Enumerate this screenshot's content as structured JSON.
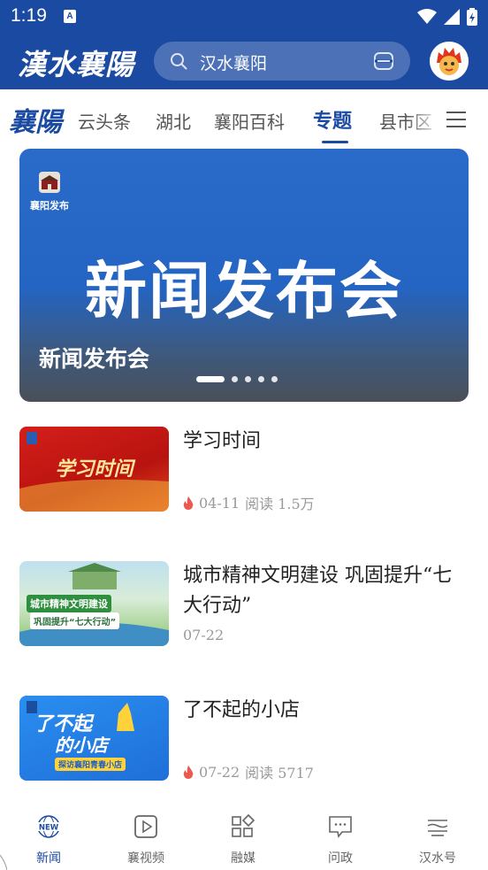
{
  "status_bar": {
    "time": "1:19",
    "notification_badge": "A"
  },
  "header": {
    "logo": "漢水襄陽",
    "search_text": "汉水襄阳",
    "brand_color": "#1b4aa3"
  },
  "tabs": {
    "logo": "襄陽",
    "items": [
      {
        "label": "云头条",
        "active": false
      },
      {
        "label": "湖北",
        "active": false
      },
      {
        "label": "襄阳百科",
        "active": false
      },
      {
        "label": "专题",
        "active": true
      },
      {
        "label": "县市区",
        "active": false
      }
    ]
  },
  "banner": {
    "badge_text": "襄阳发布",
    "headline": "新闻发布会",
    "caption": "新闻发布会",
    "slide_count": 5,
    "active_slide": 1
  },
  "news": [
    {
      "title": "学习时间",
      "thumb_text": "学习时间",
      "hot": true,
      "date": "04-11",
      "reads": "阅读 1.5万"
    },
    {
      "title": "城市精神文明建设  巩固提升“七大行动”",
      "thumb_text_1": "城市精神文明建设",
      "thumb_text_2": "巩固提升“七大行动”",
      "hot": false,
      "date": "07-22",
      "reads": ""
    },
    {
      "title": "了不起的小店",
      "thumb_text_1": "了不起",
      "thumb_text_2": "的小店",
      "thumb_text_3": "探访襄阳青春小店",
      "hot": true,
      "date": "07-22",
      "reads": "阅读 5717"
    }
  ],
  "bottom_nav": [
    {
      "label": "新闻",
      "icon": "news-globe-icon",
      "icon_text": "NEW",
      "active": true
    },
    {
      "label": "襄视频",
      "icon": "video-play-icon",
      "active": false
    },
    {
      "label": "融媒",
      "icon": "grid-icon",
      "active": false
    },
    {
      "label": "问政",
      "icon": "chat-icon",
      "active": false
    },
    {
      "label": "汉水号",
      "icon": "waves-icon",
      "active": false
    }
  ]
}
